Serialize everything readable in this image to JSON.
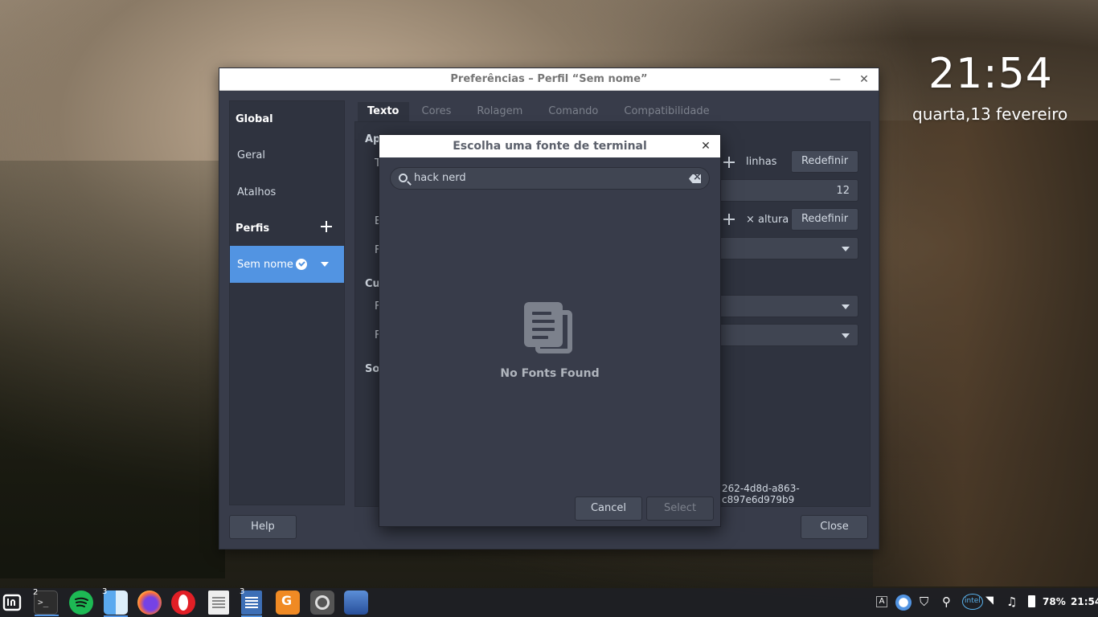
{
  "desktop": {
    "time": "21:54",
    "date": "quarta,13 fevereiro"
  },
  "prefs": {
    "title": "Preferências – Perfil “Sem nome”",
    "sidebar": {
      "global_header": "Global",
      "items": [
        "Geral",
        "Atalhos"
      ],
      "profiles_header": "Perfis",
      "profile_selected": "Sem nome"
    },
    "tabs": [
      "Texto",
      "Cores",
      "Rolagem",
      "Comando",
      "Compatibilidade"
    ],
    "content": {
      "sec1": "Ap",
      "row1": "T",
      "row3": "E",
      "row4": "F",
      "sec2": "Cu",
      "row5": "F",
      "row6": "F",
      "sec3": "Son",
      "lines_label": "linhas",
      "reset_label": "Redefinir",
      "font_size": "12",
      "height_label": "× altura",
      "uuid": "262-4d8d-a863-c897e6d979b9"
    },
    "help_label": "Help",
    "close_label": "Close"
  },
  "dialog": {
    "title": "Escolha uma fonte de terminal",
    "search_value": "hack nerd",
    "empty_message": "No Fonts Found",
    "cancel_label": "Cancel",
    "select_label": "Select"
  },
  "taskbar": {
    "apps": [
      {
        "name": "mint-menu-icon"
      },
      {
        "name": "terminal-icon",
        "badge": "2"
      },
      {
        "name": "spotify-icon"
      },
      {
        "name": "files-icon",
        "badge": "3"
      },
      {
        "name": "firefox-icon"
      },
      {
        "name": "opera-icon"
      },
      {
        "name": "text-editor-icon"
      },
      {
        "name": "writer-icon",
        "badge": "3"
      },
      {
        "name": "pdf-icon"
      },
      {
        "name": "settings-icon"
      },
      {
        "name": "image-viewer-icon"
      }
    ],
    "battery": "78%",
    "time": "21:54",
    "tray_a": "A",
    "tray_intel": "intel"
  },
  "colors": {
    "accent": "#5294e2",
    "window_bg": "#383c4a",
    "panel_bg": "#2f333f"
  }
}
